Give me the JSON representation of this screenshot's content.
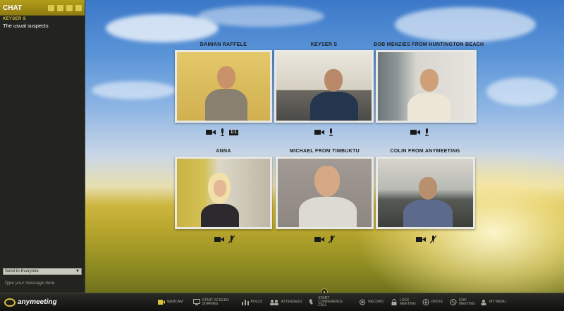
{
  "chat": {
    "title": "CHAT",
    "messages": [
      {
        "sender": "KEYSER S",
        "text": "The usual suspects"
      }
    ],
    "send_to": "Send to Everyone",
    "message_placeholder": "Type your message here"
  },
  "attendees": [
    {
      "name": "DAMIAN RAFFELE",
      "badge": "1:1"
    },
    {
      "name": "KEYSER S"
    },
    {
      "name": "BOB MENZIES FROM HUNTINGTON BEACH"
    },
    {
      "name": "ANNA"
    },
    {
      "name": "MICHAEL FROM TIMBUKTU"
    },
    {
      "name": "COLIN FROM ANYMEETING"
    }
  ],
  "toolbar": {
    "logo": "anymeeting",
    "items": [
      {
        "label": "WEBCAM",
        "icon": "webcam-icon"
      },
      {
        "label": "START SCREEN SHARING",
        "icon": "screen-share-icon"
      },
      {
        "label": "POLLS",
        "icon": "polls-icon"
      },
      {
        "label": "ATTENDEES",
        "icon": "attendees-icon"
      },
      {
        "label": "START CONFERENCE CALL",
        "icon": "conference-call-icon"
      },
      {
        "label": "RECORD",
        "icon": "record-icon"
      },
      {
        "label": "LOCK MEETING",
        "icon": "lock-icon"
      },
      {
        "label": "INVITE",
        "icon": "invite-icon"
      },
      {
        "label": "END MEETING",
        "icon": "end-meeting-icon"
      },
      {
        "label": "MY MENU",
        "icon": "menu-icon"
      }
    ]
  },
  "colors": {
    "accent": "#c9b020",
    "panel": "#232420",
    "tile_border": "#e9e9e6"
  }
}
